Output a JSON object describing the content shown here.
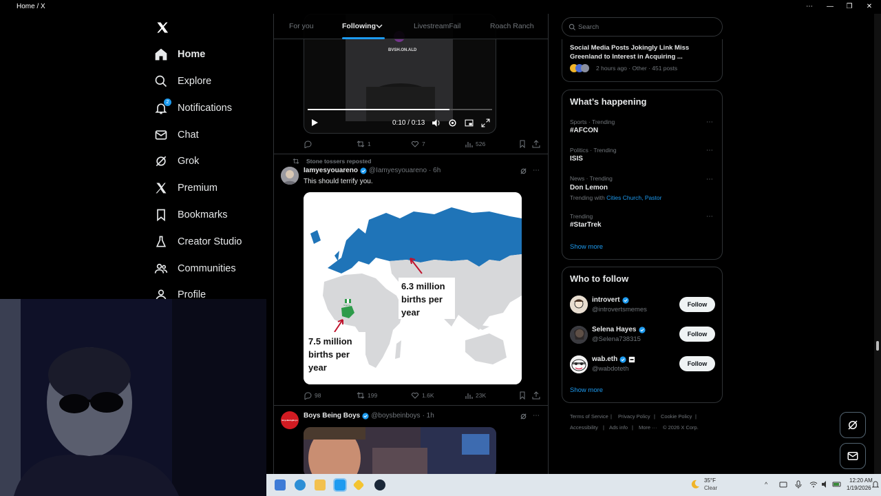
{
  "window": {
    "title": "Home / X"
  },
  "nav": {
    "items": [
      {
        "label": "Home",
        "icon": "home-icon",
        "active": true
      },
      {
        "label": "Explore",
        "icon": "search-icon"
      },
      {
        "label": "Notifications",
        "icon": "bell-icon",
        "badge": "2"
      },
      {
        "label": "Chat",
        "icon": "mail-icon"
      },
      {
        "label": "Grok",
        "icon": "grok-icon"
      },
      {
        "label": "Premium",
        "icon": "x-logo-icon"
      },
      {
        "label": "Bookmarks",
        "icon": "bookmark-icon"
      },
      {
        "label": "Creator Studio",
        "icon": "flask-icon"
      },
      {
        "label": "Communities",
        "icon": "people-icon"
      },
      {
        "label": "Profile",
        "icon": "person-icon"
      }
    ]
  },
  "tabs": [
    "For you",
    "Following",
    "LivestreamFail",
    "Roach Ranch"
  ],
  "video1": {
    "watermark": "BVSH.ON.ALD",
    "time": "0:10 / 0:13",
    "progress": 0.77
  },
  "tweet0_actions": {
    "replies": "",
    "reposts": "1",
    "likes": "7",
    "views": "526"
  },
  "tweet1": {
    "reposted_by": "Stone tossers reposted",
    "name": "Iamyesyouareno",
    "handle": "@Iamyesyouareno",
    "time": "· 6h",
    "text": "This should terrify you.",
    "map_label_1": "6.3 million births per year",
    "map_label_2": "7.5 million births per year",
    "map_flag_label": "Nigeria",
    "actions": {
      "replies": "98",
      "reposts": "199",
      "likes": "1.6K",
      "views": "23K"
    }
  },
  "tweet2": {
    "avatar_text": "BoysBeingBoys",
    "name": "Boys Being Boys",
    "handle": "@boysbeinboys",
    "time": "· 1h"
  },
  "right": {
    "search_placeholder": "Search",
    "news": {
      "title": "Social Media Posts Jokingly Link Miss Greenland to Interest in Acquiring ...",
      "meta": "2 hours ago · Other · 451 posts"
    },
    "happening": {
      "heading": "What’s happening",
      "trends": [
        {
          "meta": "Sports · Trending",
          "name": "#AFCON"
        },
        {
          "meta": "Politics · Trending",
          "name": "ISIS"
        },
        {
          "meta": "News · Trending",
          "name": "Don Lemon",
          "extra_prefix": "Trending with",
          "extra_links": "Cities Church, Pastor"
        },
        {
          "meta": "Trending",
          "name": "#StarTrek"
        }
      ],
      "show_more": "Show more"
    },
    "who_to_follow": {
      "heading": "Who to follow",
      "users": [
        {
          "name": "introvert",
          "handle": "@introvertsmemes",
          "button": "Follow"
        },
        {
          "name": "Selena Hayes",
          "handle": "@Selena738315",
          "button": "Follow"
        },
        {
          "name": "wab.eth",
          "handle": "@wabdoteth",
          "button": "Follow"
        }
      ],
      "show_more": "Show more"
    },
    "footer": {
      "links": [
        "Terms of Service",
        "Privacy Policy",
        "Cookie Policy",
        "Accessibility",
        "Ads info",
        "More ···",
        "© 2026 X Corp."
      ]
    }
  },
  "taskbar": {
    "weather_temp": "35°F",
    "weather_desc": "Clear",
    "time": "12:20 AM",
    "date": "1/19/2026"
  },
  "colors": {
    "accent": "#1d9bf0",
    "map_blue": "#1f74b8",
    "nigeria_green": "#2e9b4a",
    "arrow_red": "#c0122c"
  }
}
